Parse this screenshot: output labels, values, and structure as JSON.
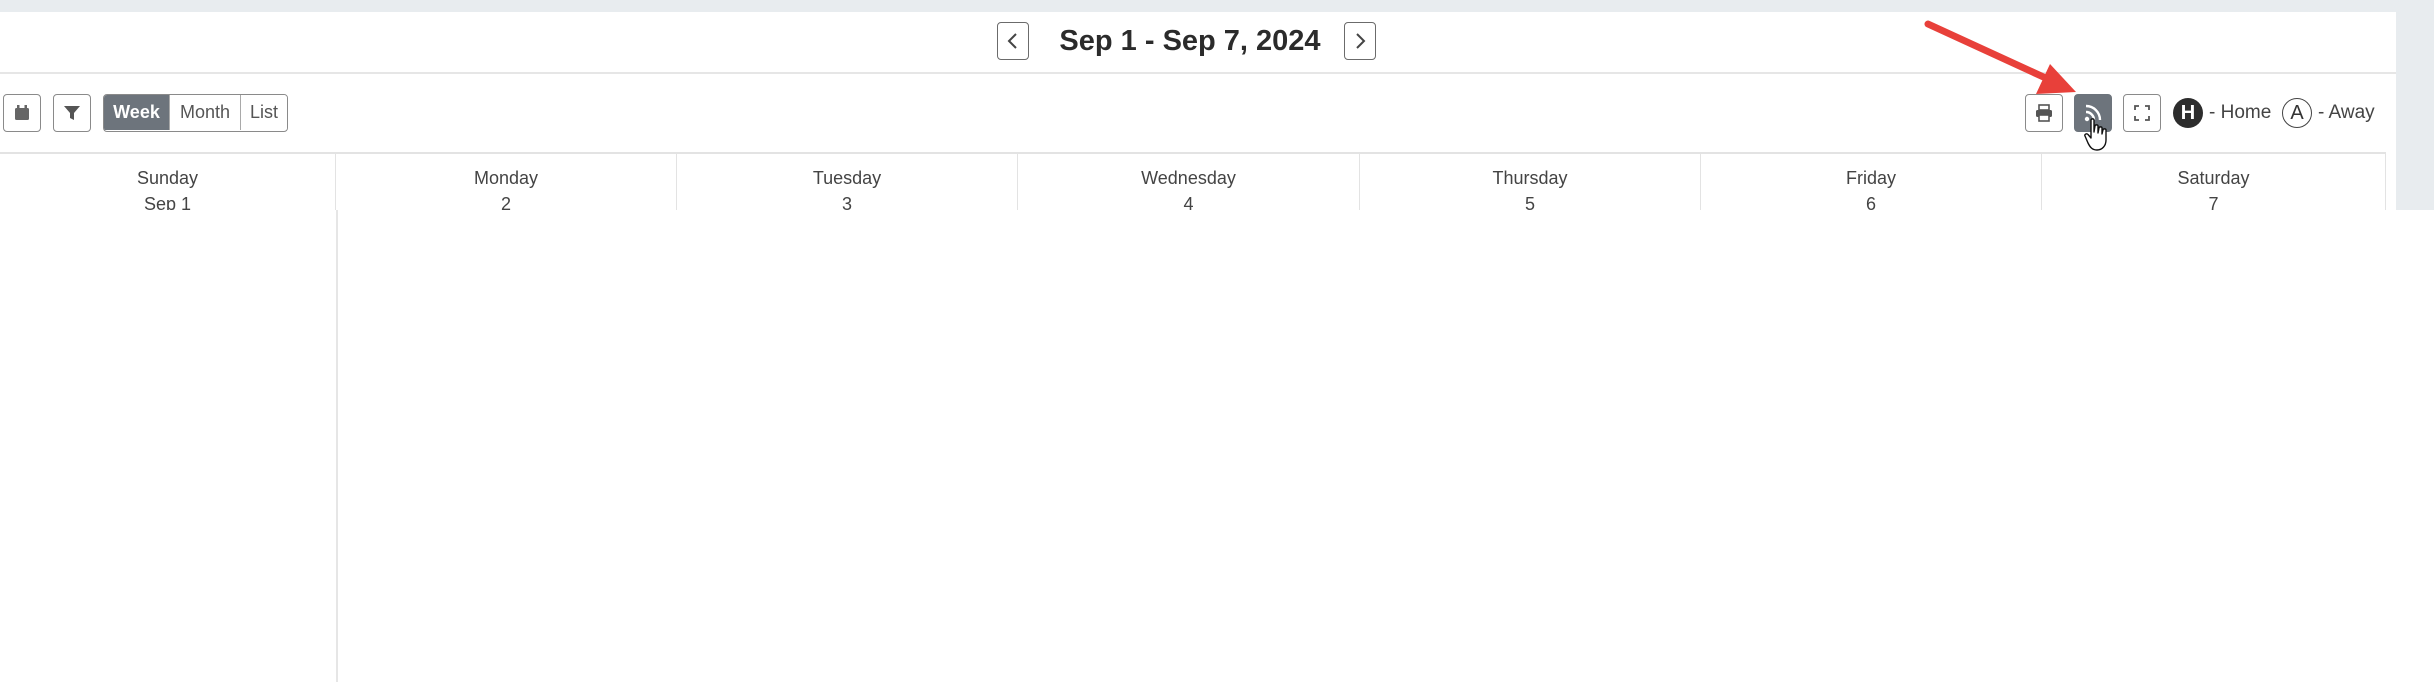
{
  "header": {
    "date_range": "Sep 1 - Sep 7, 2024",
    "prev_icon": "chevron-left-icon",
    "next_icon": "chevron-right-icon"
  },
  "toolbar": {
    "left_icons": [
      "calendar-icon",
      "filter-icon"
    ],
    "views": [
      {
        "label": "Week",
        "active": true
      },
      {
        "label": "Month",
        "active": false
      },
      {
        "label": "List",
        "active": false
      }
    ],
    "right_icons": [
      "print-icon",
      "rss-feed-icon",
      "fullscreen-icon"
    ],
    "legend": {
      "home_badge": "H",
      "home_label": "- Home",
      "away_badge": "A",
      "away_label": "- Away"
    }
  },
  "calendar": {
    "days": [
      {
        "name": "Sunday",
        "date": "Sep 1"
      },
      {
        "name": "Monday",
        "date": "2"
      },
      {
        "name": "Tuesday",
        "date": "3"
      },
      {
        "name": "Wednesday",
        "date": "4"
      },
      {
        "name": "Thursday",
        "date": "5"
      },
      {
        "name": "Friday",
        "date": "6"
      },
      {
        "name": "Saturday",
        "date": "7"
      }
    ]
  },
  "colors": {
    "active_button": "#6d747c",
    "annotation_arrow": "#e8403a",
    "home_badge": "#2d2d2d"
  }
}
